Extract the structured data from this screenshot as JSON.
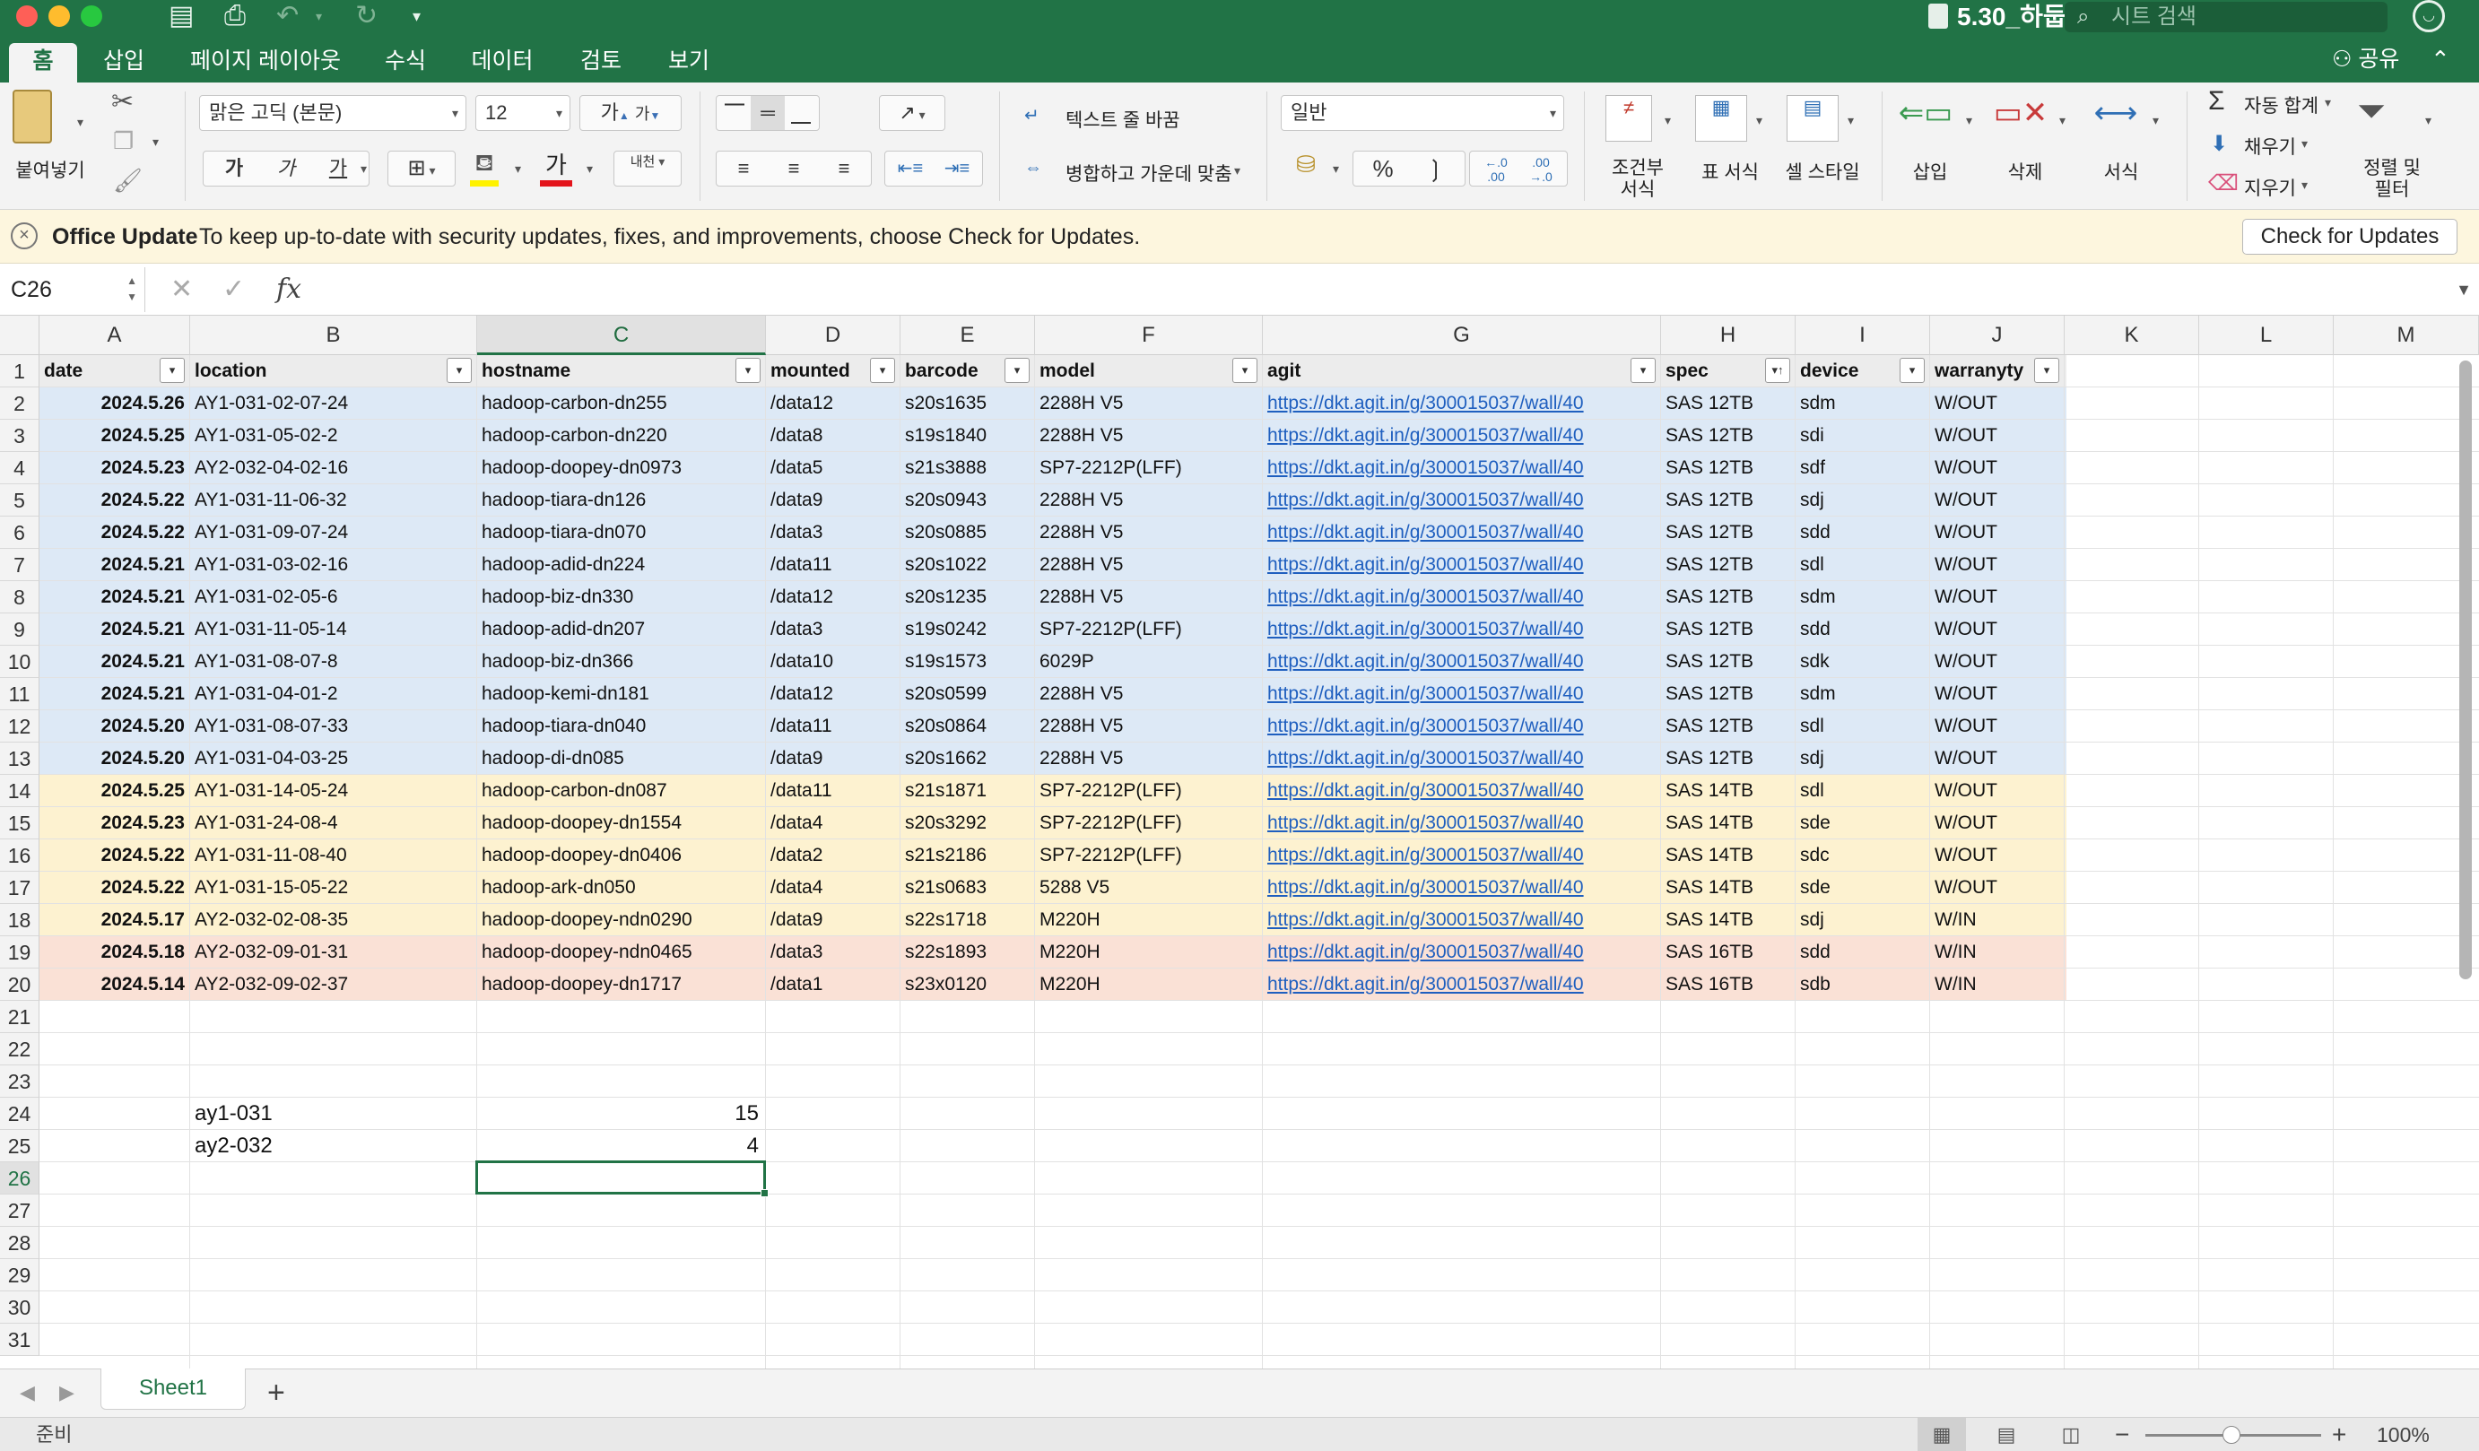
{
  "window": {
    "title": "5.30_하둡",
    "search_placeholder": "시트 검색"
  },
  "ribbon_tabs": [
    {
      "label": "홈",
      "active": true
    },
    {
      "label": "삽입",
      "active": false
    },
    {
      "label": "페이지 레이아웃",
      "active": false
    },
    {
      "label": "수식",
      "active": false
    },
    {
      "label": "데이터",
      "active": false
    },
    {
      "label": "검토",
      "active": false
    },
    {
      "label": "보기",
      "active": false
    }
  ],
  "share_label": "공유",
  "ribbon": {
    "paste_label": "붙여넣기",
    "font_name": "맑은 고딕 (본문)",
    "font_size": "12",
    "grow_font": "가",
    "shrink_font": "가",
    "bold": "가",
    "italic": "가",
    "underline": "가",
    "font_color_glyph": "가",
    "phonetic": "내천",
    "wrap_text": "텍스트 줄 바꿈",
    "merge_center": "병합하고 가운데 맞춤",
    "number_format": "일반",
    "percent": "%",
    "comma": "❳",
    "conditional_format": [
      "조건부",
      "서식"
    ],
    "format_as_table": "표 서식",
    "cell_styles": "셀 스타일",
    "insert": "삽입",
    "delete": "삭제",
    "format": "서식",
    "autosum": "자동 합계",
    "fill": "채우기",
    "clear": "지우기",
    "sort_filter": [
      "정렬 및",
      "필터"
    ]
  },
  "notification": {
    "title": "Office Update",
    "message": "To keep up-to-date with security updates, fixes, and improvements, choose Check for Updates.",
    "button": "Check for Updates"
  },
  "formula_bar": {
    "name_box": "C26",
    "fx": "fx",
    "value": ""
  },
  "columns": [
    "A",
    "B",
    "C",
    "D",
    "E",
    "F",
    "G",
    "H",
    "I",
    "J",
    "K",
    "L",
    "M"
  ],
  "selected_column": "C",
  "selected_row": 26,
  "rows_visible": 31,
  "table_headers": [
    "date",
    "location",
    "hostname",
    "mounted",
    "barcode",
    "model",
    "agit",
    "spec",
    "device",
    "warranyty"
  ],
  "table_rows": [
    {
      "date": "2024.5.26",
      "location": "AY1-031-02-07-24",
      "hostname": "hadoop-carbon-dn255",
      "mounted": "/data12",
      "barcode": "s20s1635",
      "model": "2288H V5",
      "agit": "https://dkt.agit.in/g/300015037/wall/40",
      "spec": "SAS 12TB",
      "device": "sdm",
      "warranty": "W/OUT",
      "band": "blue"
    },
    {
      "date": "2024.5.25",
      "location": "AY1-031-05-02-2",
      "hostname": "hadoop-carbon-dn220",
      "mounted": "/data8",
      "barcode": "s19s1840",
      "model": "2288H V5",
      "agit": "https://dkt.agit.in/g/300015037/wall/40",
      "spec": "SAS 12TB",
      "device": "sdi",
      "warranty": "W/OUT",
      "band": "blue"
    },
    {
      "date": "2024.5.23",
      "location": "AY2-032-04-02-16",
      "hostname": "hadoop-doopey-dn0973",
      "mounted": "/data5",
      "barcode": "s21s3888",
      "model": "SP7-2212P(LFF)",
      "agit": "https://dkt.agit.in/g/300015037/wall/40",
      "spec": "SAS 12TB",
      "device": "sdf",
      "warranty": "W/OUT",
      "band": "blue"
    },
    {
      "date": "2024.5.22",
      "location": "AY1-031-11-06-32",
      "hostname": "hadoop-tiara-dn126",
      "mounted": "/data9",
      "barcode": "s20s0943",
      "model": "2288H V5",
      "agit": "https://dkt.agit.in/g/300015037/wall/40",
      "spec": "SAS 12TB",
      "device": "sdj",
      "warranty": "W/OUT",
      "band": "blue"
    },
    {
      "date": "2024.5.22",
      "location": "AY1-031-09-07-24",
      "hostname": "hadoop-tiara-dn070",
      "mounted": "/data3",
      "barcode": "s20s0885",
      "model": "2288H V5",
      "agit": "https://dkt.agit.in/g/300015037/wall/40",
      "spec": "SAS 12TB",
      "device": "sdd",
      "warranty": "W/OUT",
      "band": "blue"
    },
    {
      "date": "2024.5.21",
      "location": "AY1-031-03-02-16",
      "hostname": "hadoop-adid-dn224",
      "mounted": "/data11",
      "barcode": "s20s1022",
      "model": "2288H V5",
      "agit": "https://dkt.agit.in/g/300015037/wall/40",
      "spec": "SAS 12TB",
      "device": "sdl",
      "warranty": "W/OUT",
      "band": "blue"
    },
    {
      "date": "2024.5.21",
      "location": "AY1-031-02-05-6",
      "hostname": "hadoop-biz-dn330",
      "mounted": "/data12",
      "barcode": "s20s1235",
      "model": "2288H V5",
      "agit": "https://dkt.agit.in/g/300015037/wall/40",
      "spec": "SAS 12TB",
      "device": "sdm",
      "warranty": "W/OUT",
      "band": "blue"
    },
    {
      "date": "2024.5.21",
      "location": "AY1-031-11-05-14",
      "hostname": "hadoop-adid-dn207",
      "mounted": "/data3",
      "barcode": "s19s0242",
      "model": "SP7-2212P(LFF)",
      "agit": "https://dkt.agit.in/g/300015037/wall/40",
      "spec": "SAS 12TB",
      "device": "sdd",
      "warranty": "W/OUT",
      "band": "blue"
    },
    {
      "date": "2024.5.21",
      "location": "AY1-031-08-07-8",
      "hostname": "hadoop-biz-dn366",
      "mounted": "/data10",
      "barcode": "s19s1573",
      "model": "6029P",
      "agit": "https://dkt.agit.in/g/300015037/wall/40",
      "spec": "SAS 12TB",
      "device": "sdk",
      "warranty": "W/OUT",
      "band": "blue"
    },
    {
      "date": "2024.5.21",
      "location": "AY1-031-04-01-2",
      "hostname": "hadoop-kemi-dn181",
      "mounted": "/data12",
      "barcode": "s20s0599",
      "model": "2288H V5",
      "agit": "https://dkt.agit.in/g/300015037/wall/40",
      "spec": "SAS 12TB",
      "device": "sdm",
      "warranty": "W/OUT",
      "band": "blue"
    },
    {
      "date": "2024.5.20",
      "location": "AY1-031-08-07-33",
      "hostname": "hadoop-tiara-dn040",
      "mounted": "/data11",
      "barcode": "s20s0864",
      "model": "2288H V5",
      "agit": "https://dkt.agit.in/g/300015037/wall/40",
      "spec": "SAS 12TB",
      "device": "sdl",
      "warranty": "W/OUT",
      "band": "blue"
    },
    {
      "date": "2024.5.20",
      "location": "AY1-031-04-03-25",
      "hostname": "hadoop-di-dn085",
      "mounted": "/data9",
      "barcode": "s20s1662",
      "model": "2288H V5",
      "agit": "https://dkt.agit.in/g/300015037/wall/40",
      "spec": "SAS 12TB",
      "device": "sdj",
      "warranty": "W/OUT",
      "band": "blue"
    },
    {
      "date": "2024.5.25",
      "location": "AY1-031-14-05-24",
      "hostname": "hadoop-carbon-dn087",
      "mounted": "/data11",
      "barcode": "s21s1871",
      "model": "SP7-2212P(LFF)",
      "agit": "https://dkt.agit.in/g/300015037/wall/40",
      "spec": "SAS 14TB",
      "device": "sdl",
      "warranty": "W/OUT",
      "band": "yellow"
    },
    {
      "date": "2024.5.23",
      "location": "AY1-031-24-08-4",
      "hostname": "hadoop-doopey-dn1554",
      "mounted": "/data4",
      "barcode": "s20s3292",
      "model": "SP7-2212P(LFF)",
      "agit": "https://dkt.agit.in/g/300015037/wall/40",
      "spec": "SAS 14TB",
      "device": "sde",
      "warranty": "W/OUT",
      "band": "yellow"
    },
    {
      "date": "2024.5.22",
      "location": "AY1-031-11-08-40",
      "hostname": "hadoop-doopey-dn0406",
      "mounted": "/data2",
      "barcode": "s21s2186",
      "model": "SP7-2212P(LFF)",
      "agit": "https://dkt.agit.in/g/300015037/wall/40",
      "spec": "SAS 14TB",
      "device": "sdc",
      "warranty": "W/OUT",
      "band": "yellow"
    },
    {
      "date": "2024.5.22",
      "location": "AY1-031-15-05-22",
      "hostname": "hadoop-ark-dn050",
      "mounted": "/data4",
      "barcode": "s21s0683",
      "model": "5288 V5",
      "agit": "https://dkt.agit.in/g/300015037/wall/40",
      "spec": "SAS 14TB",
      "device": "sde",
      "warranty": "W/OUT",
      "band": "yellow"
    },
    {
      "date": "2024.5.17",
      "location": "AY2-032-02-08-35",
      "hostname": "hadoop-doopey-ndn0290",
      "mounted": "/data9",
      "barcode": "s22s1718",
      "model": "M220H",
      "agit": "https://dkt.agit.in/g/300015037/wall/40",
      "spec": "SAS 14TB",
      "device": "sdj",
      "warranty": "W/IN",
      "band": "yellow"
    },
    {
      "date": "2024.5.18",
      "location": "AY2-032-09-01-31",
      "hostname": "hadoop-doopey-ndn0465",
      "mounted": "/data3",
      "barcode": "s22s1893",
      "model": "M220H",
      "agit": "https://dkt.agit.in/g/300015037/wall/40",
      "spec": "SAS 16TB",
      "device": "sdd",
      "warranty": "W/IN",
      "band": "pink"
    },
    {
      "date": "2024.5.14",
      "location": "AY2-032-09-02-37",
      "hostname": "hadoop-doopey-dn1717",
      "mounted": "/data1",
      "barcode": "s23x0120",
      "model": "M220H",
      "agit": "https://dkt.agit.in/g/300015037/wall/40",
      "spec": "SAS 16TB",
      "device": "sdb",
      "warranty": "W/IN",
      "band": "pink"
    }
  ],
  "summary_rows": [
    {
      "row": 24,
      "label": "ay1-031",
      "count": "15"
    },
    {
      "row": 25,
      "label": "ay2-032",
      "count": "4"
    }
  ],
  "band_colors": {
    "blue": "#dde9f6",
    "yellow": "#fdf2d0",
    "pink": "#fae1d6"
  },
  "sheet_tab": "Sheet1",
  "status": {
    "ready": "준비",
    "zoom": "100%"
  },
  "colors": {
    "accent": "#217346",
    "link": "#1f5fbf",
    "notification_bg": "#fdf6de"
  }
}
